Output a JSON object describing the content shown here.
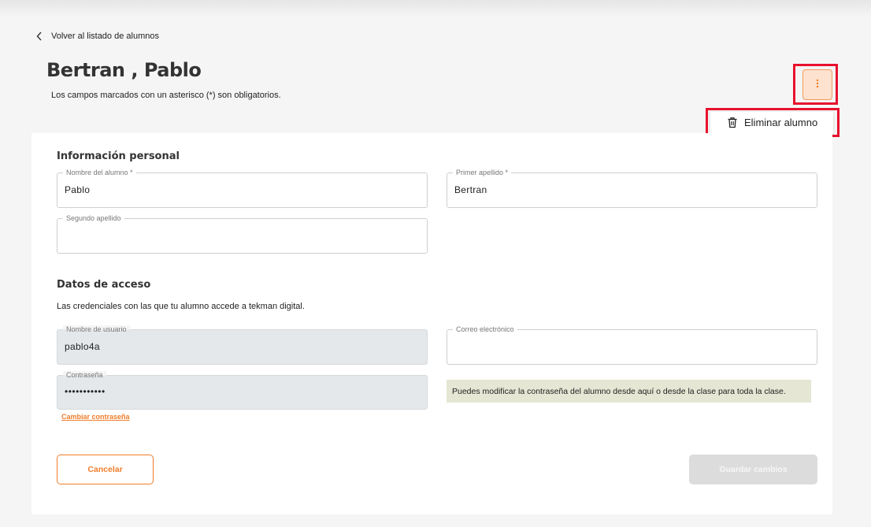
{
  "nav": {
    "back_label": "Volver al listado de alumnos"
  },
  "header": {
    "title": "Bertran , Pablo",
    "required_note": "Los campos marcados con un asterisco (*) son obligatorios.",
    "more_icon": "vertical-dots-icon"
  },
  "actions_menu": {
    "delete_label": "Eliminar alumno",
    "delete_icon": "trash-icon"
  },
  "personal": {
    "title": "Información personal",
    "first_name": {
      "label": "Nombre del alumno *",
      "value": "Pablo"
    },
    "last_name": {
      "label": "Primer apellido *",
      "value": "Bertran"
    },
    "second_last_name": {
      "label": "Segundo apellido",
      "value": ""
    }
  },
  "access": {
    "title": "Datos de acceso",
    "description": "Las credenciales con las que tu alumno accede a tekman digital.",
    "username": {
      "label": "Nombre de usuario",
      "value": "pablo4a"
    },
    "email": {
      "label": "Correo electrónico",
      "value": ""
    },
    "password": {
      "label": "Contraseña",
      "value": "•••••••••••"
    },
    "change_password_label": "Cambiar contraseña",
    "password_note": "Puedes modificar la contraseña del alumno desde aquí o desde la clase para toda la clase."
  },
  "footer": {
    "cancel_label": "Cancelar",
    "save_label": "Guardar cambios"
  },
  "colors": {
    "accent": "#f07d2a",
    "highlight": "#e8112d",
    "note_bg": "#e5e6d3",
    "disabled_field": "#e5e8eb"
  }
}
